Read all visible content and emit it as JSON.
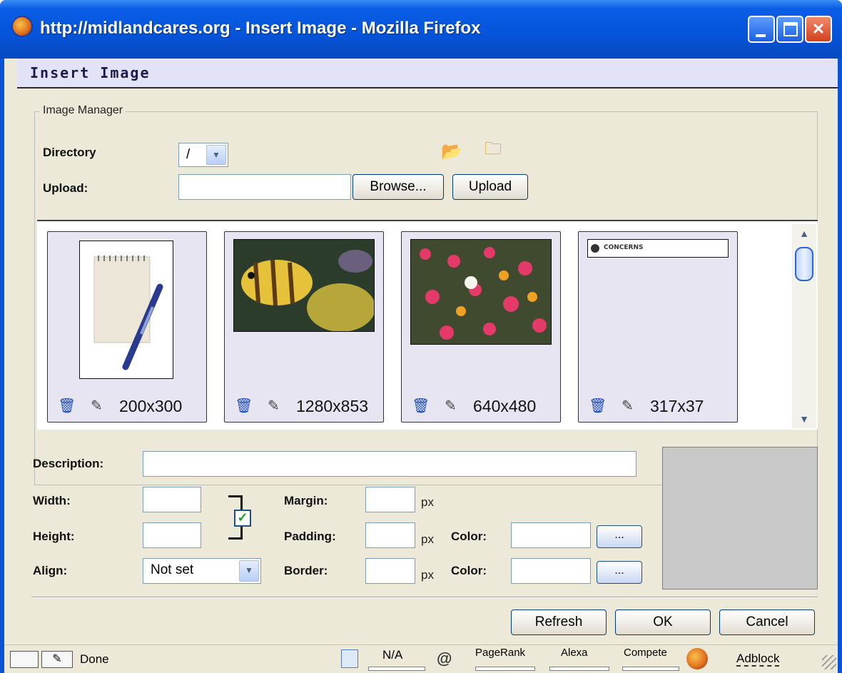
{
  "window": {
    "title": "http://midlandcares.org - Insert Image - Mozilla Firefox"
  },
  "dialog": {
    "header": "Insert Image",
    "manager_legend": "Image Manager",
    "directory_label": "Directory",
    "directory_value": "/",
    "upload_label": "Upload",
    "browse_label": "Browse...",
    "upload_button": "Upload",
    "up_folder_icon": "folder-up-icon",
    "new_folder_icon": "new-folder-icon"
  },
  "images": [
    {
      "dims": "200x300",
      "subject": "notepad-with-pen"
    },
    {
      "dims": "1280x853",
      "subject": "tropical-fish"
    },
    {
      "dims": "640x480",
      "subject": "flower-garden"
    },
    {
      "dims": "317x37",
      "subject": "concerns-banner",
      "banner_text": "CONCERNS"
    }
  ],
  "form": {
    "description_label": "Description",
    "width_label": "Width",
    "height_label": "Height",
    "align_label": "Align",
    "align_value": "Not set",
    "margin_label": "Margin",
    "padding_label": "Padding",
    "border_label": "Border",
    "color_label": "Color",
    "unit": "px",
    "color_picker_label": "...",
    "constrain_checked": true
  },
  "buttons": {
    "refresh": "Refresh",
    "ok": "OK",
    "cancel": "Cancel"
  },
  "statusbar": {
    "status": "Done",
    "na": "N/A",
    "pagerank": "PageRank",
    "alexa": "Alexa",
    "compete": "Compete",
    "adblock": "Adblock"
  },
  "colors": {
    "titlebar": "#0553d8",
    "dialog_header_bg": "#e3e3f8",
    "window_bg": "#ece9d8",
    "preview_bg": "#c8c8c8"
  }
}
